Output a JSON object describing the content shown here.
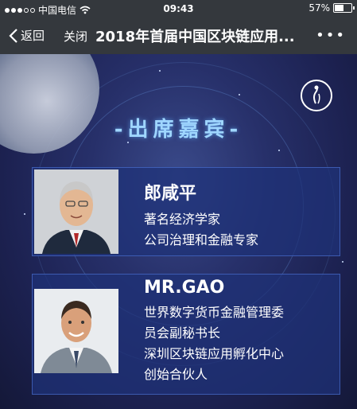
{
  "status_bar": {
    "carrier": "中国电信",
    "time": "09:43",
    "battery": "57%"
  },
  "nav": {
    "back_label": "返回",
    "close_label": "关闭",
    "title": "2018年首届中国区块链应用...",
    "more": "•••"
  },
  "page": {
    "section_title": "-出席嘉宾-"
  },
  "guests": [
    {
      "name": "郎咸平",
      "lines": [
        "著名经济学家",
        "公司治理和金融专家"
      ]
    },
    {
      "name": "MR.GAO",
      "lines": [
        "世界数字货币金融管理委",
        "员会副秘书长",
        "深圳区块链应用孵化中心",
        "创始合伙人"
      ]
    }
  ],
  "colors": {
    "bar": "#34383d",
    "title_glow": "#9fd6ff",
    "card": "#1e3278"
  }
}
